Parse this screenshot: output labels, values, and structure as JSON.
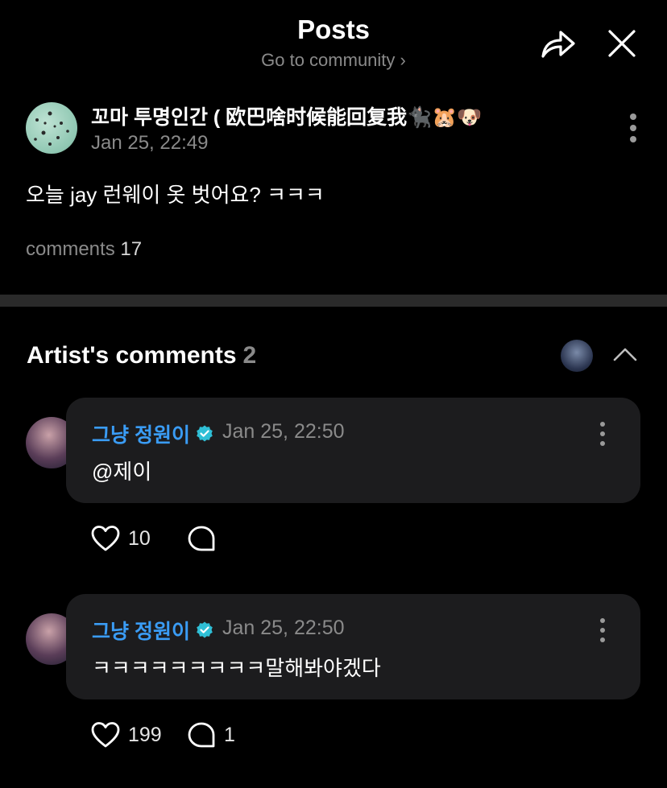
{
  "header": {
    "title": "Posts",
    "subtitle": "Go to community ›",
    "share_icon": "share-icon",
    "close_icon": "close-icon"
  },
  "post": {
    "author": "꼬마 투명인간 ( 欧巴啥时候能回复我🐈‍⬛🐹🐶",
    "time": "Jan 25, 22:49",
    "body": "오늘 jay 런웨이 옷 벗어요? ㅋㅋㅋ",
    "comments_label": "comments",
    "comments_count": "17"
  },
  "artist_comments": {
    "title": "Artist's comments",
    "count": "2",
    "items": [
      {
        "name": "그냥 정원이",
        "time": "Jan 25, 22:50",
        "text": "@제이",
        "likes": "10",
        "replies": ""
      },
      {
        "name": "그냥 정원이",
        "time": "Jan 25, 22:50",
        "text": "ㅋㅋㅋㅋㅋㅋㅋㅋㅋ말해봐야겠다",
        "likes": "199",
        "replies": "1"
      }
    ]
  },
  "colors": {
    "background": "#000000",
    "bubble": "#1c1c1e",
    "artist_name": "#3a9cf5",
    "muted": "#8a8a8a"
  }
}
